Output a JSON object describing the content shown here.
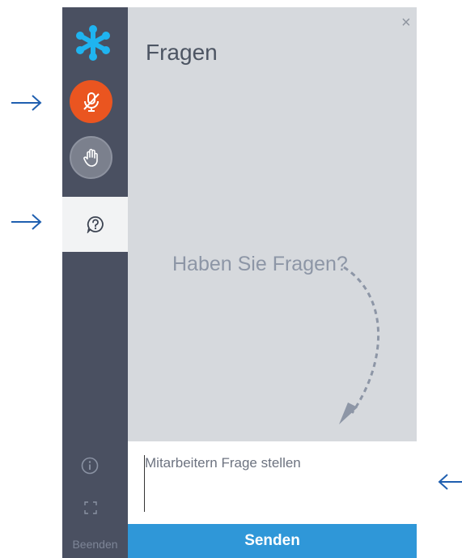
{
  "sidebar": {
    "end_label": "Beenden",
    "icons": {
      "logo": "snowflake-logo-icon",
      "mic": "microphone-muted-icon",
      "hand": "raise-hand-icon",
      "questions": "question-bubble-icon",
      "info": "info-icon",
      "fullscreen": "fullscreen-icon"
    }
  },
  "panel": {
    "title": "Fragen",
    "close_label": "×",
    "prompt": "Haben Sie Fragen?"
  },
  "question": {
    "placeholder": "Mitarbeitern Frage stellen",
    "value": ""
  },
  "send_label": "Senden",
  "colors": {
    "sidebar": "#4a5061",
    "accent_orange": "#ea5520",
    "send_blue": "#2f97d8",
    "logo_blue": "#1fb4f0",
    "guide_arrow_blue": "#1f5fb0"
  }
}
